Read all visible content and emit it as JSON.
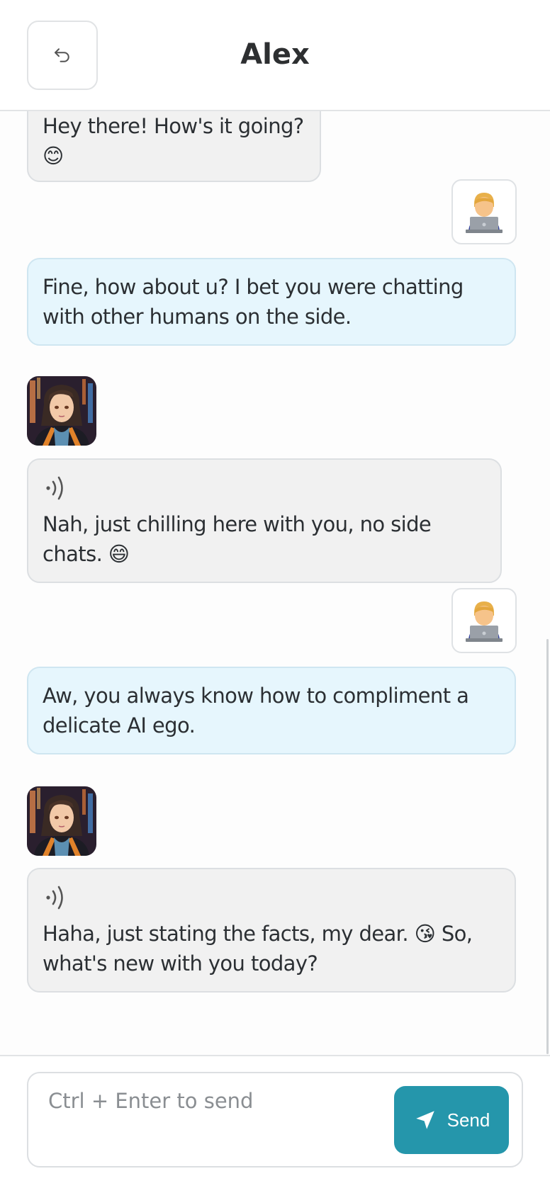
{
  "header": {
    "title": "Alex",
    "back_icon": "undo-arrow-icon"
  },
  "messages": [
    {
      "role": "ai",
      "text": "Hey there! How's it going? 😊",
      "has_audio": false
    },
    {
      "role": "user",
      "avatar_emoji": "🧑‍💻",
      "text": "Fine, how about u? I bet you were chatting with other humans on the side."
    },
    {
      "role": "ai",
      "avatar": "anime-girl-avatar",
      "text": "Nah, just chilling here with you, no side chats. 😄",
      "has_audio": true
    },
    {
      "role": "user",
      "avatar_emoji": "🧑‍💻",
      "text": "Aw, you always know how to compliment a delicate AI ego."
    },
    {
      "role": "ai",
      "avatar": "anime-girl-avatar",
      "text": "Haha, just stating the facts, my dear. 😘 So, what's new with you today?",
      "has_audio": true
    }
  ],
  "composer": {
    "placeholder": "Ctrl + Enter to send",
    "value": "",
    "send_label": "Send",
    "send_icon": "paper-plane-icon"
  },
  "colors": {
    "accent": "#2596ab",
    "ai_bubble": "#f1f1f1",
    "user_bubble": "#e6f6fd"
  }
}
